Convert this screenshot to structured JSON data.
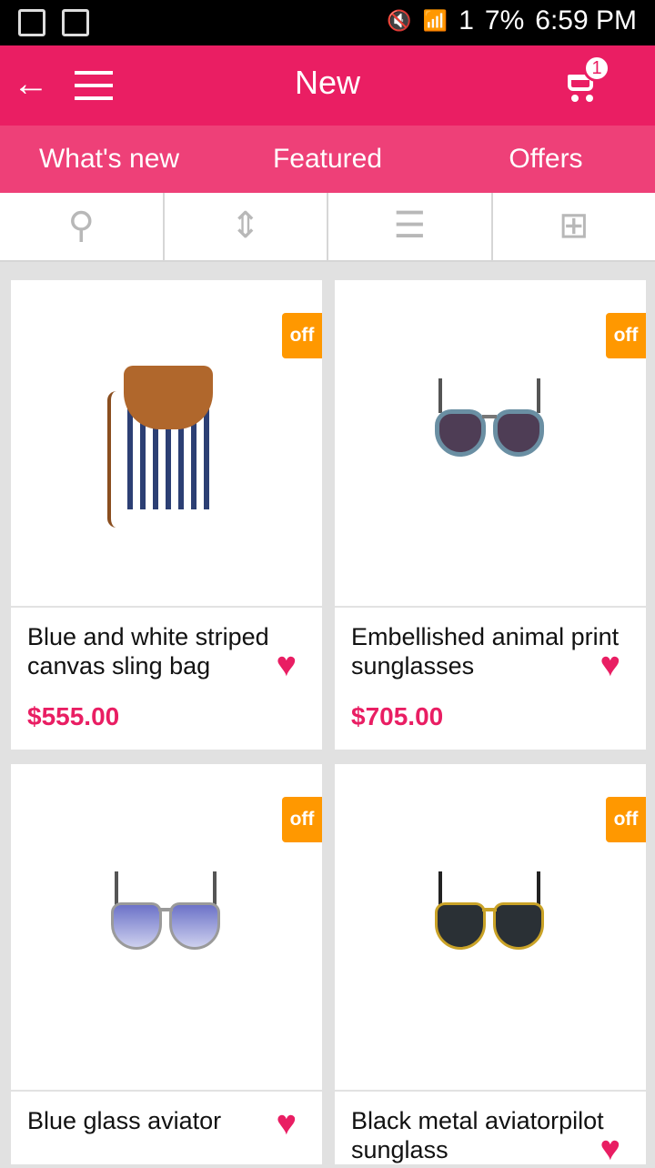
{
  "status": {
    "battery": "7%",
    "time": "6:59 PM",
    "sim": "1"
  },
  "header": {
    "title": "New",
    "cart_count": "1"
  },
  "tabs": [
    "What's new",
    "Featured",
    "Offers"
  ],
  "products": [
    {
      "name": "Blue and white striped canvas sling bag",
      "price": "$555.00",
      "badge": "off"
    },
    {
      "name": "Embellished animal print sunglasses",
      "price": "$705.00",
      "badge": "off"
    },
    {
      "name": "Blue glass aviator",
      "price": "",
      "badge": "off"
    },
    {
      "name": "Black metal aviatorpilot sunglass",
      "price": "",
      "badge": "off"
    }
  ],
  "colors": {
    "accent": "#ea1e63",
    "tab_bar": "#ee4078",
    "badge": "#ff9800"
  }
}
